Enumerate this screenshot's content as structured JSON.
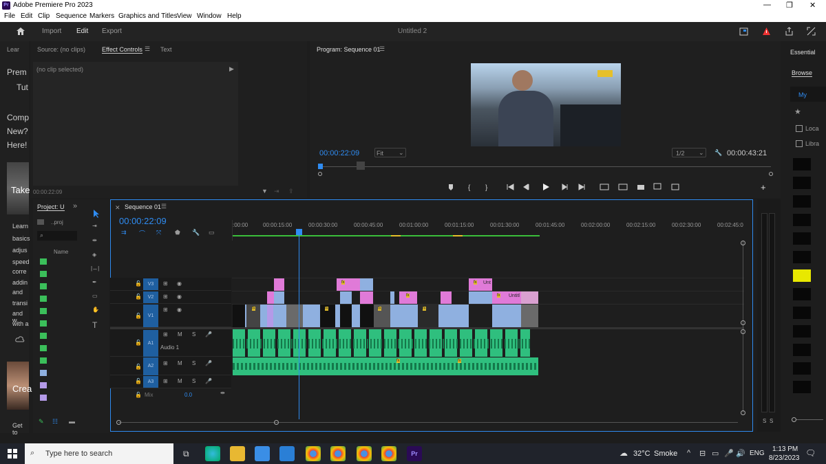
{
  "window": {
    "title": "Adobe Premiere Pro 2023",
    "app_icon": "Pr",
    "controls": [
      "—",
      "❐",
      "✕"
    ]
  },
  "menu": [
    "File",
    "Edit",
    "Clip",
    "Sequence",
    "Markers",
    "Graphics and Titles",
    "View",
    "Window",
    "Help"
  ],
  "header": {
    "tabs": [
      "Import",
      "Edit",
      "Export"
    ],
    "active_tab": "Edit",
    "document_title": "Untitled 2"
  },
  "left_strip": {
    "tab": "Lear",
    "lines": [
      "Prem",
      "Tut",
      "Comp",
      "New?",
      "Here!",
      "Take",
      "Learn",
      "basics",
      "adjus",
      "speed",
      "corre",
      "addin",
      "and",
      "transi",
      "and w",
      "with a",
      "Crea",
      "Get to"
    ]
  },
  "source_panel": {
    "tabs": [
      "Source: (no clips)",
      "Effect Controls",
      "Text"
    ],
    "active_tab": "Effect Controls",
    "no_clip": "(no clip selected)",
    "timecode": "00:00:22:09"
  },
  "program": {
    "title": "Program: Sequence 01",
    "timecode": "00:00:22:09",
    "fit": "Fit",
    "resolution": "1/2",
    "duration": "00:00:43:21"
  },
  "essential": {
    "tab": "Essential",
    "browse": "Browse",
    "my": "My",
    "locale": "Loca",
    "library": "Libra"
  },
  "project": {
    "tab": "Project: U",
    "file": "..proj",
    "name_col": "Name"
  },
  "sequence": {
    "tab": "Sequence 01",
    "timecode": "00:00:22:09",
    "ruler": [
      ":00:00",
      "00:00:15:00",
      "00:00:30:00",
      "00:00:45:00",
      "00:01:00:00",
      "00:01:15:00",
      "00:01:30:00",
      "00:01:45:00",
      "00:02:00:00",
      "00:02:15:00",
      "00:02:30:00",
      "00:02:45:0"
    ],
    "tracks": {
      "v3": "V3",
      "v2": "V2",
      "v1": "V1",
      "a1": "A1",
      "a1_name": "Audio 1",
      "a2": "A2",
      "a3": "A3",
      "mix": "Mix",
      "mix_val": "0.0"
    },
    "clip_labels": {
      "unt": "Unt",
      "untitl": "Untitl",
      "fx": "fx"
    }
  },
  "taskbar": {
    "search_placeholder": "Type here to search",
    "temp": "32°C",
    "weather": "Smoke",
    "lang": "ENG",
    "time": "1:13 PM",
    "date": "8/23/2023"
  },
  "colors": {
    "accent": "#2f8cf2",
    "video_clip": "#8fb0e0",
    "pink_clip": "#e07ad8",
    "audio_clip": "#2fbf7e"
  }
}
